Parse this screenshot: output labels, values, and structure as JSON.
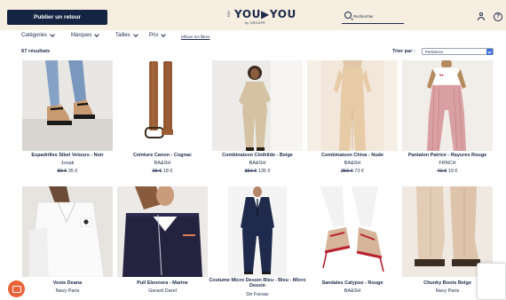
{
  "header": {
    "publish_button": "Publier un retour",
    "logo_prefix": "PAR",
    "logo_main": "YOU▶YOU",
    "logo_sub": "by GROUPE",
    "search_placeholder": "Rechercher",
    "help_label": "?"
  },
  "filters": {
    "categories": "Catégories",
    "brands": "Marques",
    "sizes": "Tailles",
    "price": "Prix",
    "clear": "Effacer les filtres"
  },
  "results": {
    "count": "67 résultats",
    "sort_label": "Trier par :",
    "sort_value": "Pertinence"
  },
  "products": [
    {
      "title": "Espadrilles Sibel Velours - Noir",
      "brand": "Jonak",
      "old_price": "80 €",
      "new_price": "35 €"
    },
    {
      "title": "Ceinture Canon - Cognac",
      "brand": "BA&SH",
      "old_price": "95 €",
      "new_price": "18 €"
    },
    {
      "title": "Combinaison Clothilde - Beige",
      "brand": "BA&SH",
      "old_price": "350 €",
      "new_price": "135 €"
    },
    {
      "title": "Combinaison Chiva - Nude",
      "brand": "BA&SH",
      "old_price": "250 €",
      "new_price": "73 €"
    },
    {
      "title": "Pantalon Patrice - Rayures Rouge",
      "brand": "FRNCH",
      "old_price": "40 €",
      "new_price": "19 €"
    },
    {
      "title": "Veste Deana",
      "brand": "Navy Paris",
      "old_price": "",
      "new_price": ""
    },
    {
      "title": "Pull Eleonora - Marine",
      "brand": "Gerard Darel",
      "old_price": "",
      "new_price": ""
    },
    {
      "title": "Costume Micro Dessin Bleu - Bleu - Micro Dessin",
      "brand": "De Fursac",
      "old_price": "",
      "new_price": ""
    },
    {
      "title": "Sandales Calypso - Rouge",
      "brand": "BA&SH",
      "old_price": "",
      "new_price": ""
    },
    {
      "title": "Chunky Boots Beige",
      "brand": "Navy Paris",
      "old_price": "",
      "new_price": ""
    }
  ],
  "icons": {
    "search": "search-icon",
    "user": "user-icon",
    "help": "help-icon",
    "chat": "chat-icon"
  },
  "colors": {
    "header_bg": "#f7eee2",
    "primary": "#152541",
    "chat": "#ea6338",
    "sort_accent": "#3a6fd8"
  }
}
